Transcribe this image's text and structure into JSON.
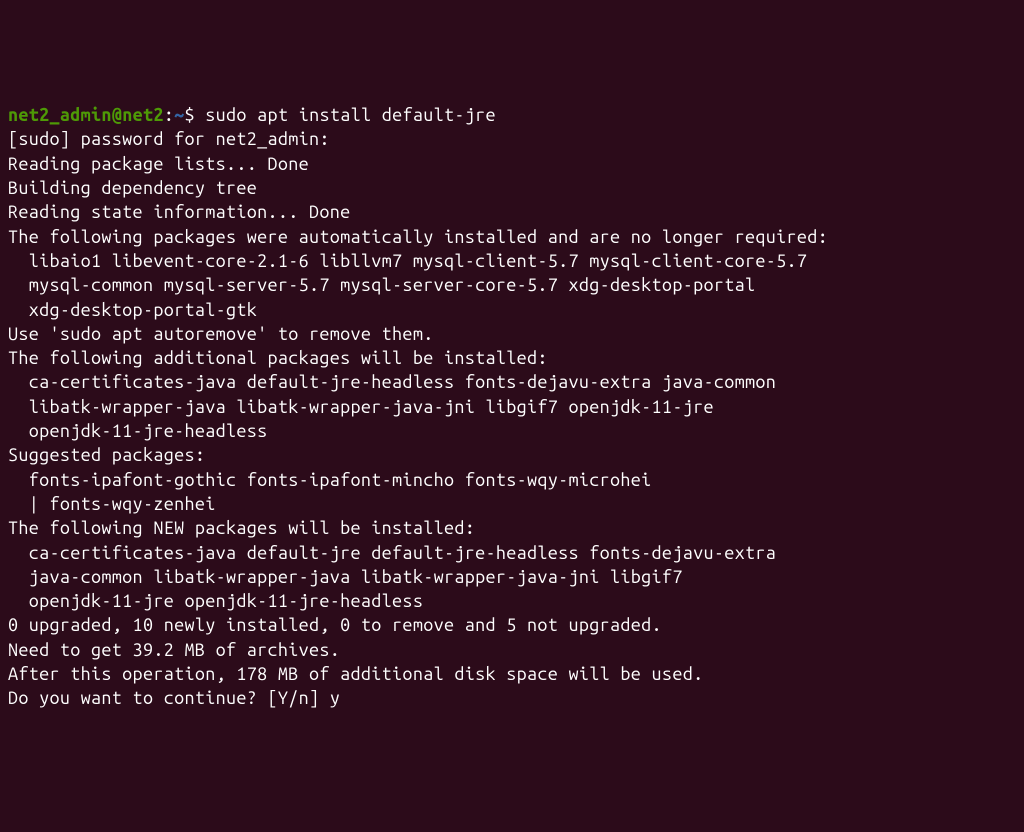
{
  "prompt": {
    "user": "net2_admin",
    "at": "@",
    "host": "net2",
    "colon": ":",
    "path": "~",
    "dollar": "$ "
  },
  "command": "sudo apt install default-jre",
  "lines": {
    "l1": "[sudo] password for net2_admin:",
    "l2": "Reading package lists... Done",
    "l3": "Building dependency tree",
    "l4": "Reading state information... Done",
    "l5": "The following packages were automatically installed and are no longer required:",
    "l6": "  libaio1 libevent-core-2.1-6 libllvm7 mysql-client-5.7 mysql-client-core-5.7",
    "l7": "  mysql-common mysql-server-5.7 mysql-server-core-5.7 xdg-desktop-portal",
    "l8": "  xdg-desktop-portal-gtk",
    "l9": "Use 'sudo apt autoremove' to remove them.",
    "l10": "The following additional packages will be installed:",
    "l11": "  ca-certificates-java default-jre-headless fonts-dejavu-extra java-common",
    "l12": "  libatk-wrapper-java libatk-wrapper-java-jni libgif7 openjdk-11-jre",
    "l13": "  openjdk-11-jre-headless",
    "l14": "Suggested packages:",
    "l15": "  fonts-ipafont-gothic fonts-ipafont-mincho fonts-wqy-microhei",
    "l16": "  | fonts-wqy-zenhei",
    "l17": "The following NEW packages will be installed:",
    "l18": "  ca-certificates-java default-jre default-jre-headless fonts-dejavu-extra",
    "l19": "  java-common libatk-wrapper-java libatk-wrapper-java-jni libgif7",
    "l20": "  openjdk-11-jre openjdk-11-jre-headless",
    "l21": "0 upgraded, 10 newly installed, 0 to remove and 5 not upgraded.",
    "l22": "Need to get 39.2 MB of archives.",
    "l23": "After this operation, 178 MB of additional disk space will be used.",
    "l24": "Do you want to continue? [Y/n] y"
  }
}
